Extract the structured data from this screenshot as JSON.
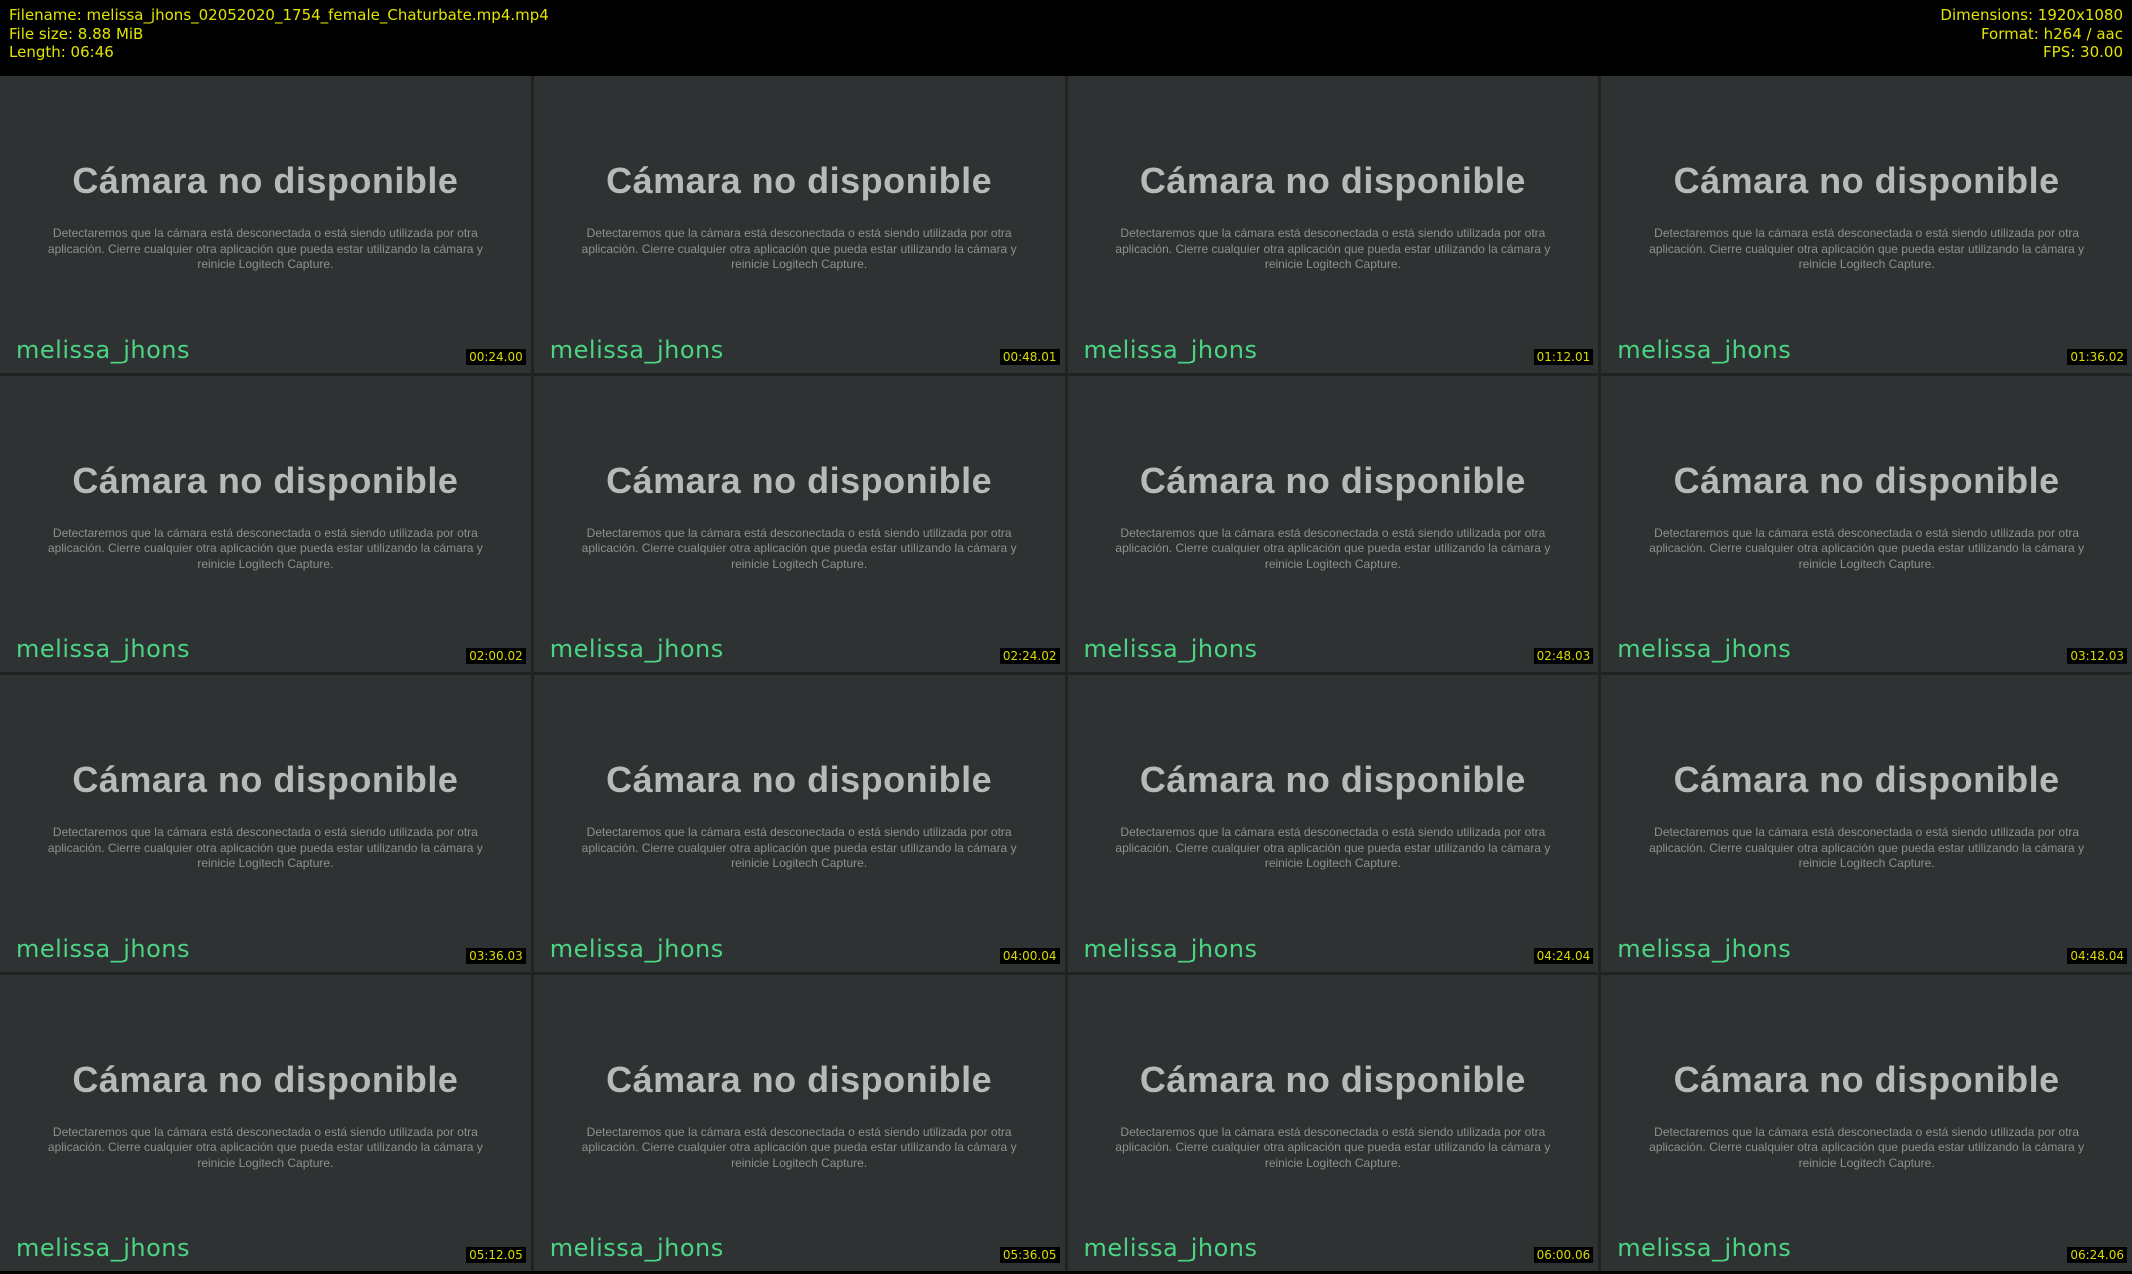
{
  "header": {
    "left_lines": [
      "Filename: melissa_jhons_02052020_1754_female_Chaturbate.mp4.mp4",
      "File size: 8.88 MiB",
      "Length: 06:46"
    ],
    "right_lines": [
      "Dimensions: 1920x1080",
      "Format: h264 / aac",
      "FPS: 30.00"
    ]
  },
  "frame": {
    "title": "Cámara no disponible",
    "body_lines": [
      "Detectaremos que la cámara está desconectada o está siendo utilizada por otra",
      "aplicación. Cierre cualquier otra aplicación que pueda estar utilizando la cámara y",
      "reinicie Logitech Capture."
    ],
    "watermark": "melissa_jhons"
  },
  "timestamps": [
    "00:24.00",
    "00:48.01",
    "01:12.01",
    "01:36.02",
    "02:00.02",
    "02:24.02",
    "02:48.03",
    "03:12.03",
    "03:36.03",
    "04:00.04",
    "04:24.04",
    "04:48.04",
    "05:12.05",
    "05:36.05",
    "06:00.06",
    "06:24.06"
  ],
  "colors": {
    "header_background": "#000000",
    "header_text": "#e2e400",
    "tile_background": "#2f3232",
    "grid_gap": "#212323",
    "frame_title_text": "#b8bab9",
    "frame_body_text": "#8e918f",
    "watermark_text": "#4bd583",
    "timestamp_text": "#dcdc00",
    "timestamp_background": "#000000"
  }
}
